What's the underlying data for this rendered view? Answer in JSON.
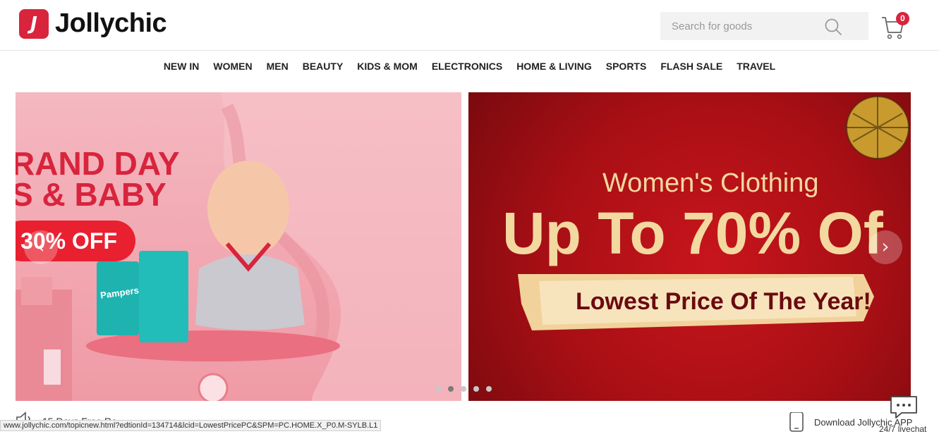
{
  "brand": {
    "name": "Jollychic",
    "mark": "J"
  },
  "search": {
    "placeholder": "Search for goods"
  },
  "cart": {
    "count": "0"
  },
  "nav": {
    "items": [
      "NEW IN",
      "WOMEN",
      "MEN",
      "BEAUTY",
      "KIDS & MOM",
      "ELECTRONICS",
      "HOME & LIVING",
      "SPORTS",
      "FLASH SALE",
      "TRAVEL"
    ]
  },
  "banners": {
    "left": {
      "line1": "RAND DAY",
      "line2": "S & BABY",
      "discount": "30% OFF",
      "product": "Pampers"
    },
    "right": {
      "subtitle": "Women's Clothing",
      "headline": "Up To 70% Of",
      "ribbon": "Lowest Price Of The Year!"
    }
  },
  "carousel": {
    "dot_count": 5,
    "active_index": 1
  },
  "below": {
    "text": "15 Days Free Re"
  },
  "status_bar": {
    "url": "www.jollychic.com/topicnew.html?edtionId=134714&lcid=LowestPricePC&SPM=PC.HOME.X_P0.M-SYLB.L1"
  },
  "footer": {
    "download_label": "Download Jollychic APP",
    "livechat_label": "24/7 livechat"
  },
  "colors": {
    "brand_red": "#d8243d",
    "gold": "#f3d8a0",
    "left_banner": "#f2a7b1",
    "right_banner": "#b3111a"
  }
}
